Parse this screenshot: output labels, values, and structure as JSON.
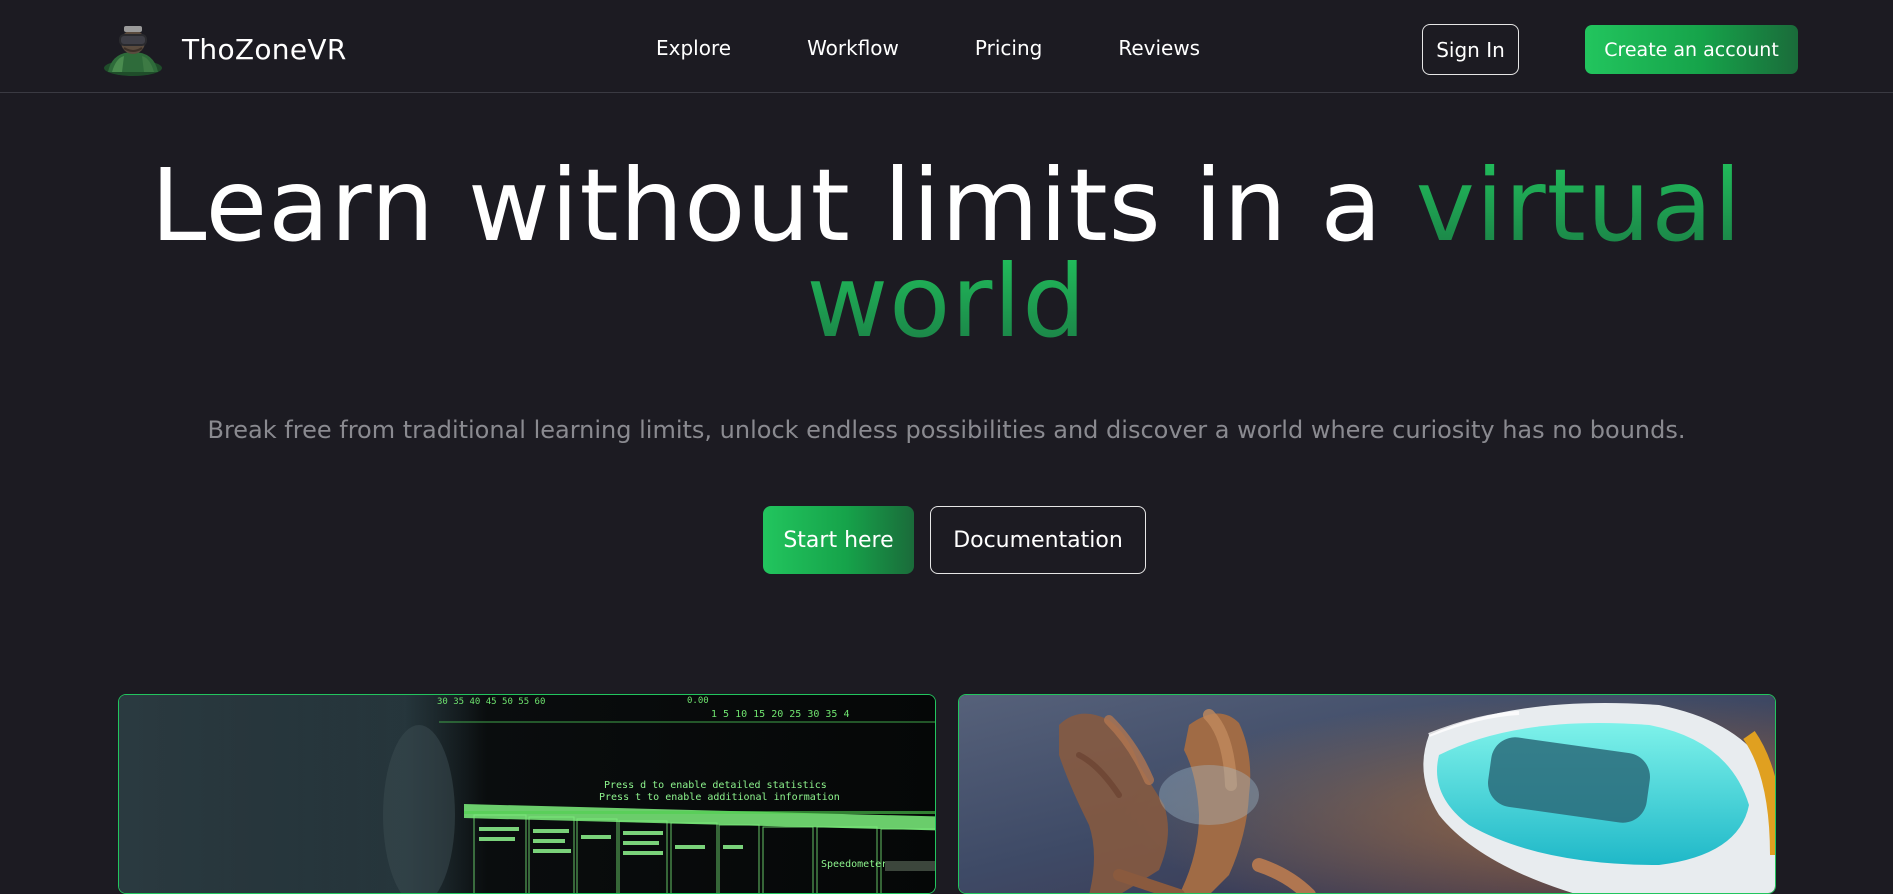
{
  "header": {
    "brand": "ThoZoneVR",
    "nav": [
      "Explore",
      "Workflow",
      "Pricing",
      "Reviews"
    ],
    "sign_in": "Sign In",
    "create_account": "Create an account"
  },
  "hero": {
    "title_white": "Learn without limits in a",
    "title_green_1": "virtual",
    "title_green_2": "world",
    "subtitle": "Break free from traditional learning limits, unlock endless possibilities and discover a world where curiosity has no bounds.",
    "primary_cta": "Start here",
    "secondary_cta": "Documentation"
  },
  "cards": {
    "left": {
      "scale_top_left": "30 35 40 45 50 55 60",
      "scale_top_right_value": "0.00",
      "scale_top_right": "1 5 10 15 20 25 30 35 4",
      "line1": "Press d to enable detailed statistics",
      "line2": "Press t to enable additional information",
      "speedometer": "Speedometer"
    },
    "right": {}
  },
  "colors": {
    "background": "#1c1b22",
    "accent": "#22c55e",
    "accent_dark": "#1a6b3a",
    "muted_text": "#8a8a90"
  },
  "icons": {
    "logo": "vr-headset-avatar-logo"
  }
}
